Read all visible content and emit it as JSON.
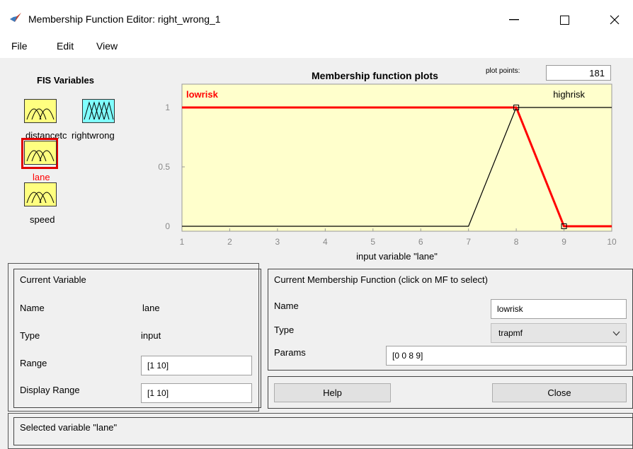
{
  "window": {
    "title": "Membership Function Editor: right_wrong_1",
    "minimize_glyph": "—",
    "maximize_glyph": "☐",
    "close_glyph": "✕"
  },
  "menu": [
    "File",
    "Edit",
    "View"
  ],
  "fis_variables": {
    "label": "FIS Variables",
    "items": [
      {
        "name": "distancetc",
        "kind": "input",
        "selected": false
      },
      {
        "name": "rightwrong",
        "kind": "output",
        "selected": false
      },
      {
        "name": "lane",
        "kind": "input",
        "selected": true
      },
      {
        "name": "speed",
        "kind": "input",
        "selected": false
      }
    ]
  },
  "plot": {
    "title": "Membership function plots",
    "plot_points_label": "plot points:",
    "plot_points_value": "181"
  },
  "chart_data": {
    "type": "line",
    "xlabel": "input variable \"lane\"",
    "xlim": [
      1,
      10
    ],
    "ylim": [
      0,
      1
    ],
    "xticks": [
      "1",
      "2",
      "3",
      "4",
      "5",
      "6",
      "7",
      "8",
      "9",
      "10"
    ],
    "yticks": [
      "0",
      "0.5",
      "1"
    ],
    "series": [
      {
        "name": "lowrisk",
        "color": "#ff0000",
        "selected": true,
        "x": [
          1,
          8,
          9,
          10
        ],
        "y": [
          1,
          1,
          0,
          0
        ]
      },
      {
        "name": "highrisk",
        "color": "#000000",
        "selected": false,
        "x": [
          1,
          7,
          8,
          10
        ],
        "y": [
          0,
          0,
          1,
          1
        ]
      }
    ]
  },
  "current_variable": {
    "header": "Current Variable",
    "name_label": "Name",
    "name_value": "lane",
    "type_label": "Type",
    "type_value": "input",
    "range_label": "Range",
    "range_value": "[1 10]",
    "display_range_label": "Display Range",
    "display_range_value": "[1 10]"
  },
  "current_mf": {
    "header": "Current Membership Function (click on MF to select)",
    "name_label": "Name",
    "name_value": "lowrisk",
    "type_label": "Type",
    "type_value": "trapmf",
    "params_label": "Params",
    "params_value": "[0 0 8 9]"
  },
  "buttons": {
    "help": "Help",
    "close": "Close"
  },
  "status": "Selected variable \"lane\"",
  "colors": {
    "plot_bg": "#ffffcc",
    "mf_box_input": "#ffff80",
    "mf_box_output": "#80ffff",
    "selected": "#ff0000"
  }
}
